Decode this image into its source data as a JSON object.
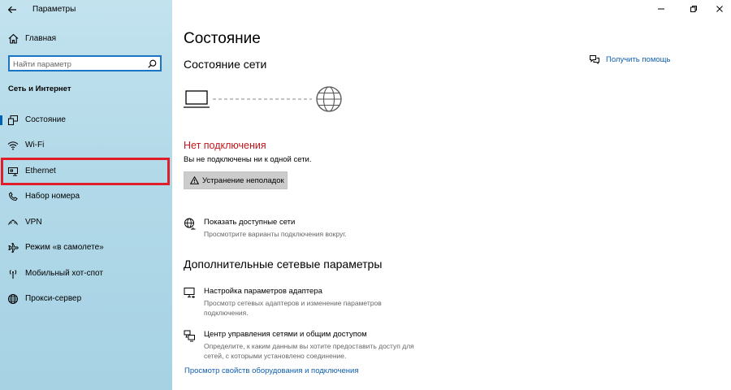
{
  "window": {
    "title": "Параметры",
    "controls": [
      "minimize",
      "maximize",
      "close"
    ]
  },
  "sidebar": {
    "home_label": "Главная",
    "search_placeholder": "Найти параметр",
    "section_title": "Сеть и Интернет",
    "items": [
      {
        "label": "Состояние",
        "icon": "status-icon",
        "active": true
      },
      {
        "label": "Wi-Fi",
        "icon": "wifi-icon",
        "active": false
      },
      {
        "label": "Ethernet",
        "icon": "ethernet-icon",
        "active": false,
        "highlighted": true
      },
      {
        "label": "Набор номера",
        "icon": "dialup-icon",
        "active": false
      },
      {
        "label": "VPN",
        "icon": "vpn-icon",
        "active": false
      },
      {
        "label": "Режим «в самолете»",
        "icon": "airplane-icon",
        "active": false
      },
      {
        "label": "Мобильный хот-спот",
        "icon": "hotspot-icon",
        "active": false
      },
      {
        "label": "Прокси-сервер",
        "icon": "globe-icon",
        "active": false
      }
    ]
  },
  "main": {
    "page_title": "Состояние",
    "network_status_title": "Состояние сети",
    "help_link": "Получить помощь",
    "connection_status": "Нет подключения",
    "connection_desc": "Вы не подключены ни к одной сети.",
    "troubleshoot_label": "Устранение неполадок",
    "show_networks": {
      "title": "Показать доступные сети",
      "desc": "Просмотрите варианты подключения вокруг."
    },
    "advanced_title": "Дополнительные сетевые параметры",
    "adapter_settings": {
      "title": "Настройка параметров адаптера",
      "desc": "Просмотр сетевых адаптеров и изменение параметров подключения."
    },
    "network_center": {
      "title": "Центр управления сетями и общим доступом",
      "desc": "Определите, к каким данным вы хотите предоставить доступ для сетей, с которыми установлено соединение."
    },
    "hardware_link": "Просмотр свойств оборудования и подключения"
  },
  "colors": {
    "accent": "#0063b1",
    "link": "#0f5fb0",
    "error": "#c4161c",
    "highlight_frame": "#e11d2a"
  }
}
